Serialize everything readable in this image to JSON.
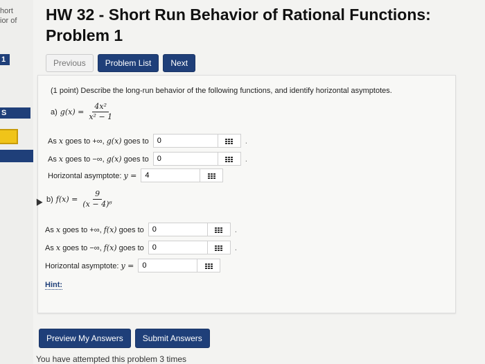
{
  "sidebar": {
    "line1": "hort",
    "line2": "ior of",
    "badge_number": "1",
    "badge_s": "S"
  },
  "header": {
    "title_line1": "HW 32 - Short Run Behavior of Rational Functions:",
    "title_line2": "Problem 1"
  },
  "nav": {
    "previous": "Previous",
    "problem_list": "Problem List",
    "next": "Next"
  },
  "problem": {
    "intro": "(1 point) Describe the long-run behavior of the following functions, and identify horizontal asymptotes.",
    "part_a": {
      "label": "a)",
      "func": "g(x) =",
      "numerator": "4x²",
      "denominator": "x² − 1",
      "rows": [
        {
          "text_pre": "As",
          "var": "x",
          "text_mid": "goes to",
          "dir": "+∞,",
          "fn": "g(x)",
          "text_post": "goes to",
          "value": "0"
        },
        {
          "text_pre": "As",
          "var": "x",
          "text_mid": "goes to",
          "dir": "−∞,",
          "fn": "g(x)",
          "text_post": "goes to",
          "value": "0"
        }
      ],
      "asymptote_label": "Horizontal asymptote:",
      "asymptote_eq": "y =",
      "asymptote_value": "4"
    },
    "part_b": {
      "label": "b)",
      "func": "f(x) =",
      "numerator": "9",
      "denominator": "(x − 4)⁶",
      "rows": [
        {
          "text_pre": "As",
          "var": "x",
          "text_mid": "goes to",
          "dir": "+∞,",
          "fn": "f(x)",
          "text_post": "goes to",
          "value": "0"
        },
        {
          "text_pre": "As",
          "var": "x",
          "text_mid": "goes to",
          "dir": "−∞,",
          "fn": "f(x)",
          "text_post": "goes to",
          "value": "0"
        }
      ],
      "asymptote_label": "Horizontal asymptote:",
      "asymptote_eq": "y =",
      "asymptote_value": "0"
    },
    "hint": "Hint:"
  },
  "actions": {
    "preview": "Preview My Answers",
    "submit": "Submit Answers"
  },
  "status": {
    "attempts": "You have attempted this problem 3 times"
  },
  "icons": {
    "equation_editor": "grid-icon",
    "cursor": "pointer-cursor-icon"
  },
  "colors": {
    "accent": "#1f3f79",
    "highlight": "#f0c419"
  }
}
